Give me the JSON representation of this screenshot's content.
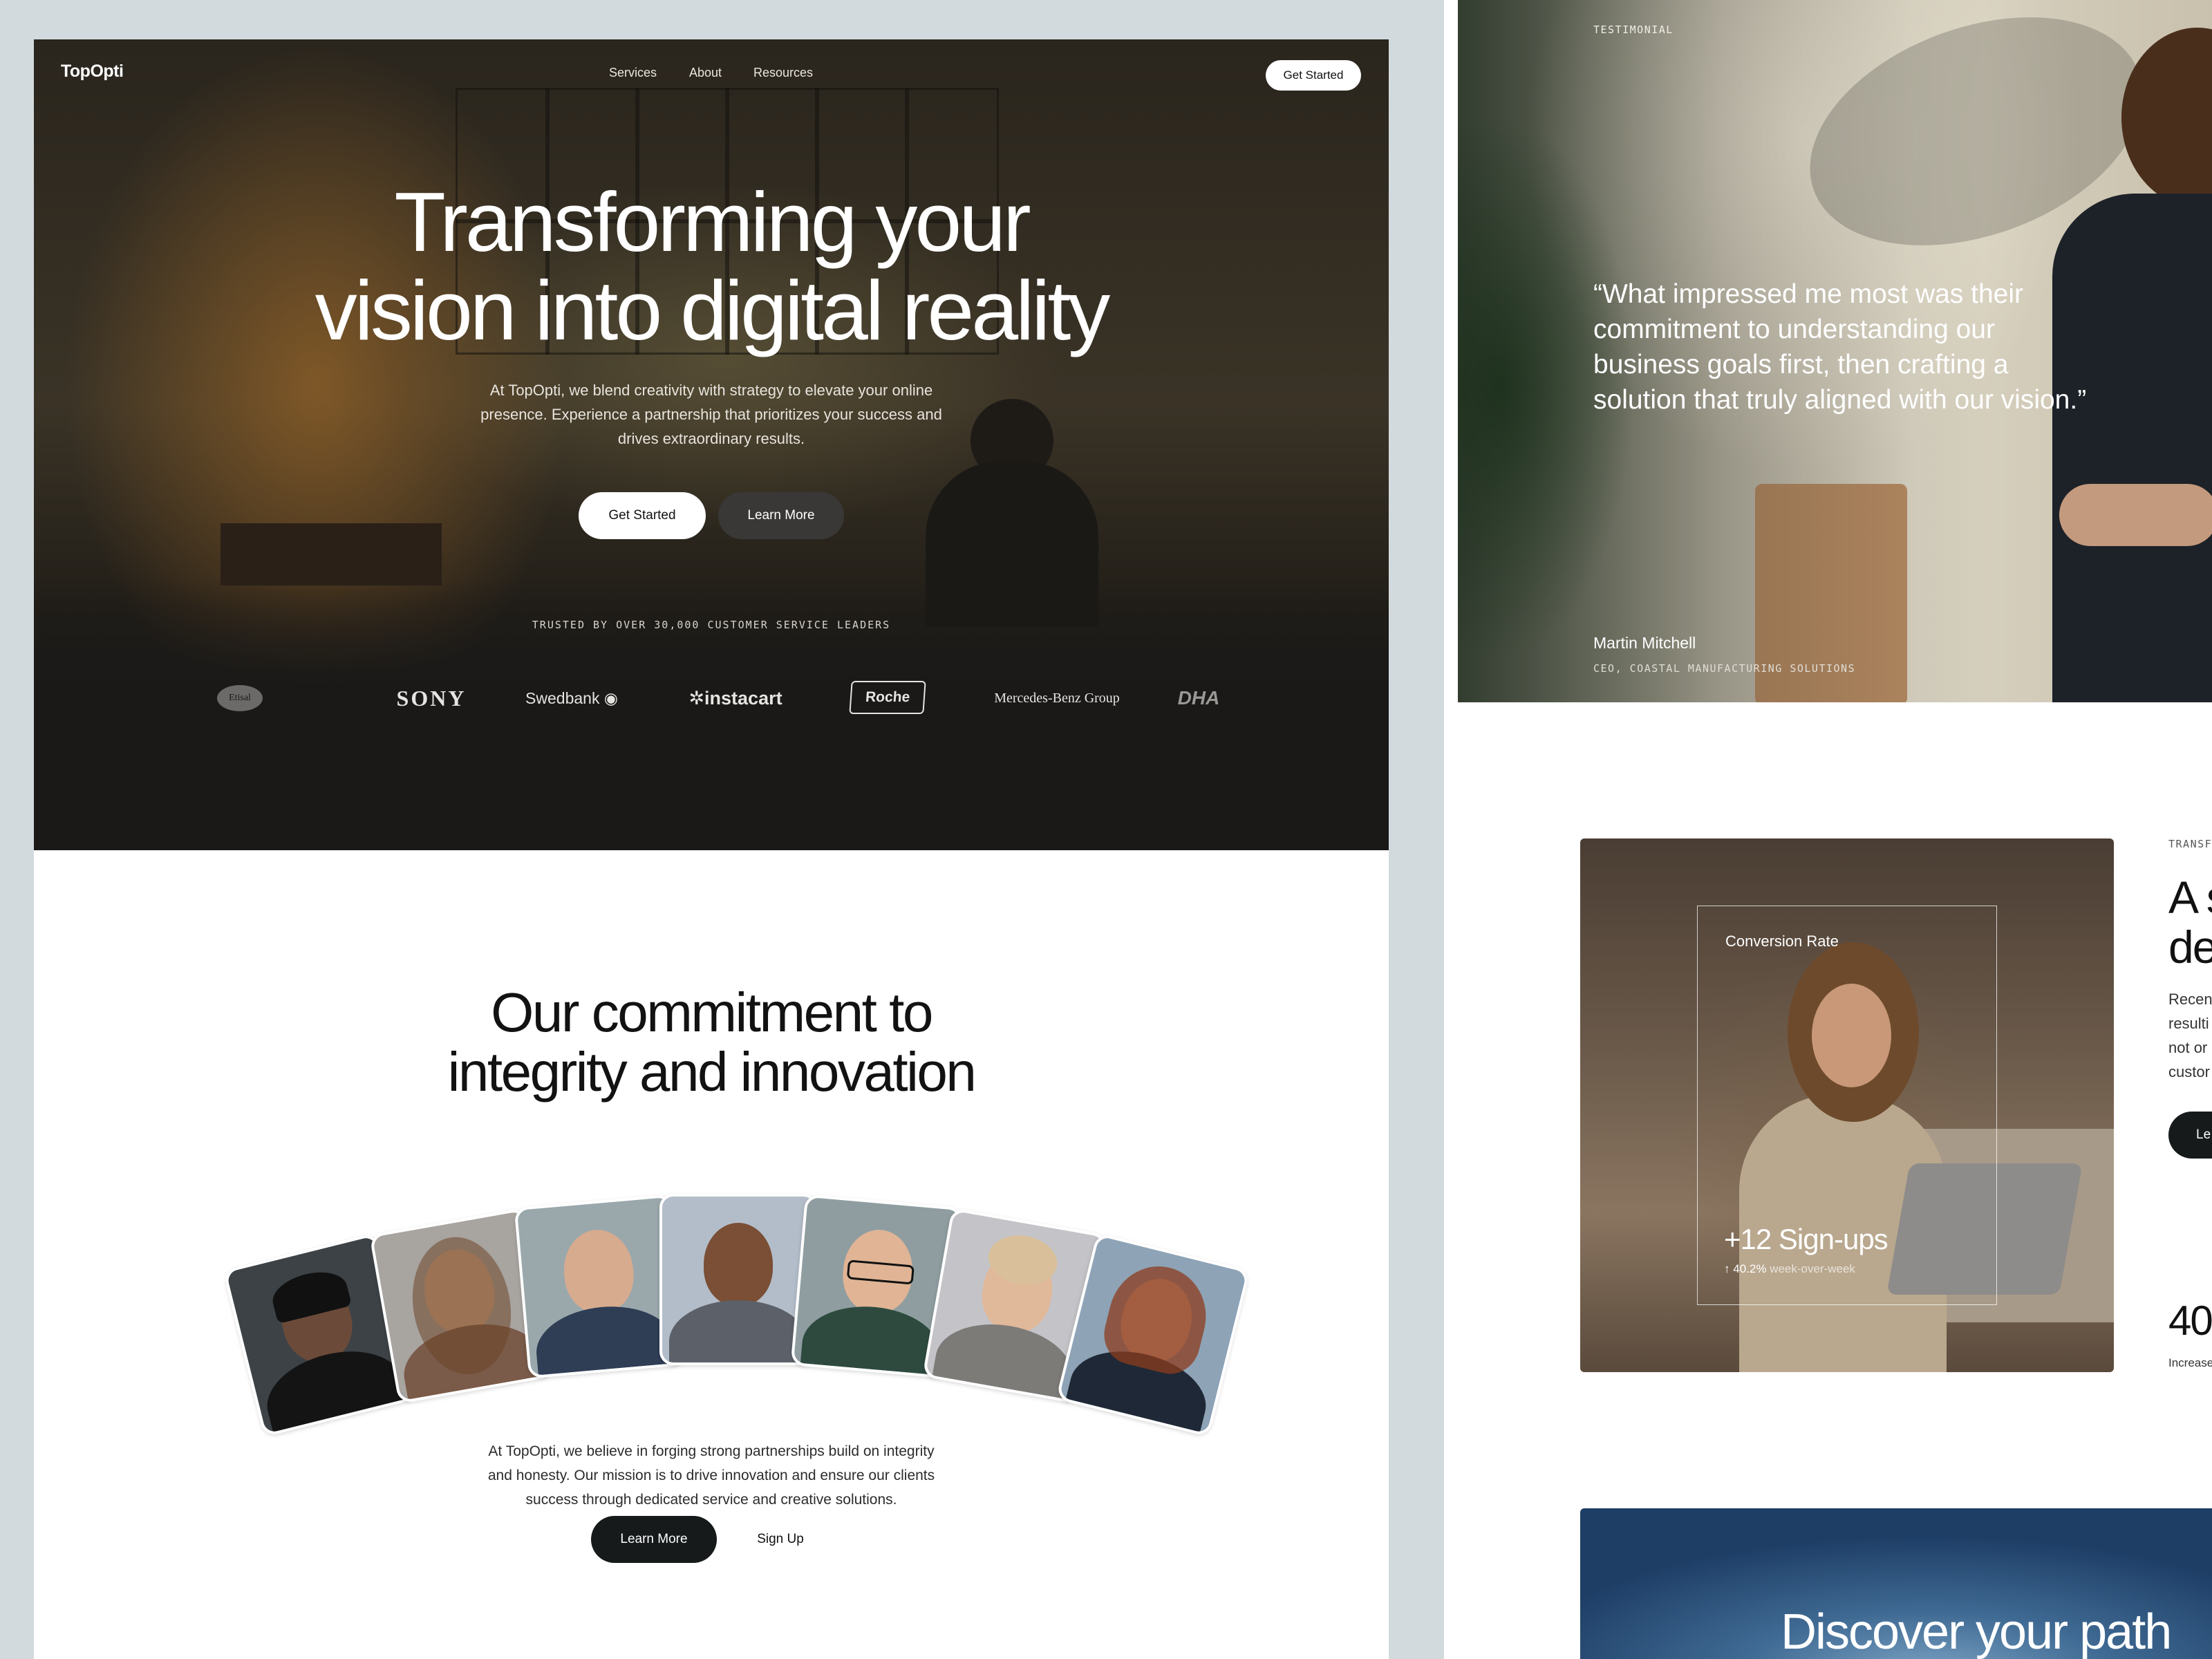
{
  "hero": {
    "brand": "TopOpti",
    "nav": [
      "Services",
      "About",
      "Resources"
    ],
    "nav_cta": "Get Started",
    "title_line1": "Transforming your",
    "title_line2": "vision into digital reality",
    "subtitle_line1": "At TopOpti, we blend creativity with strategy to elevate your online",
    "subtitle_line2": "presence. Experience a partnership that prioritizes your success and",
    "subtitle_line3": "drives extraordinary results.",
    "cta_primary": "Get Started",
    "cta_secondary": "Learn More",
    "trusted": "TRUSTED BY OVER 30,000 CUSTOMER SERVICE LEADERS",
    "logos": {
      "etisalat": "Etisal",
      "sony": "SONY",
      "swedbank": "Swedbank",
      "instacart": "instacart",
      "roche": "Roche",
      "mercedes": "Mercedes-Benz Group",
      "dha": "DHA"
    }
  },
  "commitment": {
    "title_line1": "Our commitment to",
    "title_line2": "integrity and innovation",
    "text_line1": "At TopOpti, we believe in forging strong partnerships build on integrity",
    "text_line2": "and honesty. Our mission is to drive innovation and ensure our clients",
    "text_line3": "success through dedicated service and creative solutions.",
    "cta_primary": "Learn More",
    "cta_secondary": "Sign Up"
  },
  "testimonial": {
    "tag": "TESTIMONIAL",
    "quote_line1": "“What impressed me most was their",
    "quote_line2": "commitment to understanding our",
    "quote_line3": "business goals first, then crafting a",
    "quote_line4": "solution that truly aligned with our vision.”",
    "name": "Martin Mitchell",
    "role": "CEO, COASTAL MANUFACTURING SOLUTIONS"
  },
  "growth_card": {
    "title": "Conversion Rate",
    "value": "+12 Sign-ups",
    "delta": "40.2%",
    "delta_label": "week-over-week"
  },
  "transform": {
    "tag": "TRANSF",
    "title_line1": "A s",
    "title_line2": "de",
    "text_line1": "Recen",
    "text_line2": "resulti",
    "text_line3": "not or",
    "text_line4": "custor",
    "cta": "Le",
    "stat": "40",
    "stat_label": "Increase"
  },
  "discover": {
    "title": "Discover your path"
  },
  "colors": {
    "page_bg": "#d3dade",
    "hero_dark": "#1a1918",
    "button_dark": "#161a1b",
    "button_light": "#ffffff"
  }
}
